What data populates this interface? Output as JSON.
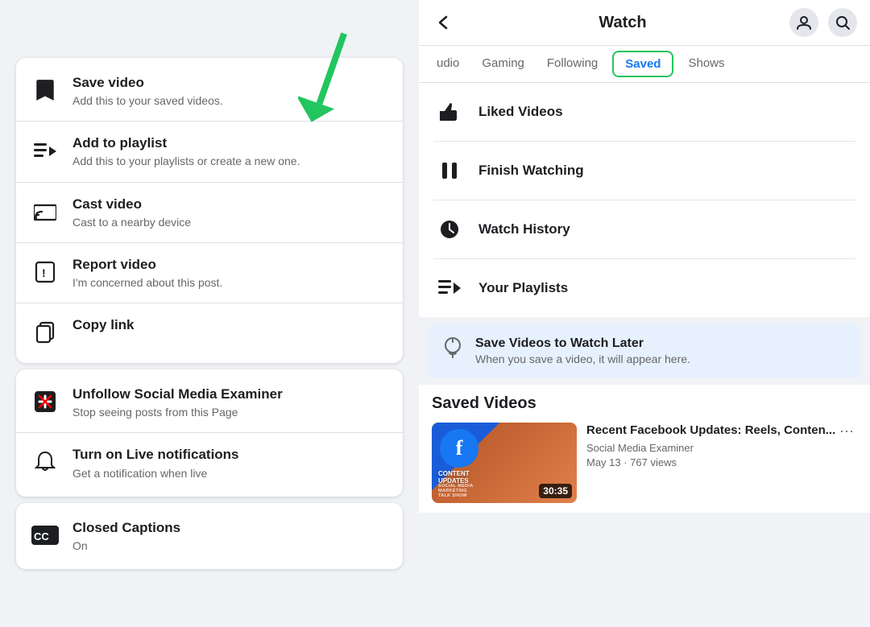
{
  "left": {
    "menu_card_1": {
      "items": [
        {
          "id": "save-video",
          "title": "Save video",
          "subtitle": "Add this to your saved videos.",
          "icon": "bookmark"
        },
        {
          "id": "add-to-playlist",
          "title": "Add to playlist",
          "subtitle": "Add this to your playlists or create a new one.",
          "icon": "playlist"
        },
        {
          "id": "cast-video",
          "title": "Cast video",
          "subtitle": "Cast to a nearby device",
          "icon": "cast"
        },
        {
          "id": "report-video",
          "title": "Report video",
          "subtitle": "I'm concerned about this post.",
          "icon": "report"
        },
        {
          "id": "copy-link",
          "title": "Copy link",
          "subtitle": "",
          "icon": "copy"
        }
      ]
    },
    "menu_card_2": {
      "items": [
        {
          "id": "unfollow",
          "title": "Unfollow Social Media Examiner",
          "subtitle": "Stop seeing posts from this Page",
          "icon": "unfollow"
        },
        {
          "id": "live-notifications",
          "title": "Turn on Live notifications",
          "subtitle": "Get a notification when live",
          "icon": "bell"
        }
      ]
    },
    "menu_card_3": {
      "items": [
        {
          "id": "closed-captions",
          "title": "Closed Captions",
          "subtitle": "On",
          "icon": "cc"
        }
      ]
    }
  },
  "right": {
    "header": {
      "title": "Watch",
      "back_label": "←"
    },
    "tabs": [
      {
        "id": "audio",
        "label": "udio",
        "active": false
      },
      {
        "id": "gaming",
        "label": "Gaming",
        "active": false
      },
      {
        "id": "following",
        "label": "Following",
        "active": false
      },
      {
        "id": "saved",
        "label": "Saved",
        "active": true
      },
      {
        "id": "shows",
        "label": "Shows",
        "active": false
      }
    ],
    "saved_items": [
      {
        "id": "liked-videos",
        "label": "Liked Videos",
        "icon": "thumbs-up"
      },
      {
        "id": "finish-watching",
        "label": "Finish Watching",
        "icon": "pause"
      },
      {
        "id": "watch-history",
        "label": "Watch History",
        "icon": "clock"
      },
      {
        "id": "your-playlists",
        "label": "Your Playlists",
        "icon": "playlist"
      }
    ],
    "info_box": {
      "title": "Save Videos to Watch Later",
      "subtitle": "When you save a video, it will appear here."
    },
    "saved_videos_section": {
      "title": "Saved Videos",
      "video": {
        "title": "Recent Facebook Updates: Reels, Conten...",
        "channel": "Social Media Examiner",
        "meta": "May 13 · 767 views",
        "duration": "30:35"
      }
    }
  }
}
